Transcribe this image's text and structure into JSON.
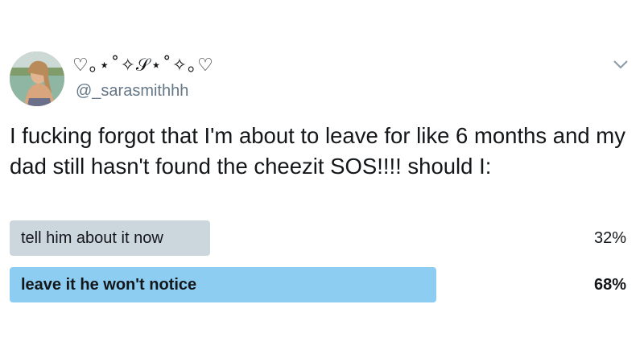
{
  "user": {
    "display_name": "♡｡⋆˚✧𝒮⋆˚✧｡♡",
    "handle": "@_sarasmithhh"
  },
  "tweet": {
    "text": "I fucking forgot that I'm about to leave for like 6 months and my dad still hasn't found the cheezit SOS!!!! should I:"
  },
  "poll": {
    "options": [
      {
        "label": "tell him about it now",
        "percent": "32%",
        "value": 32,
        "leading": false
      },
      {
        "label": "leave it he won't notice",
        "percent": "68%",
        "value": 68,
        "leading": true
      }
    ]
  },
  "colors": {
    "text": "#14171a",
    "secondary": "#657786",
    "poll_bar": "#ccd6dd",
    "poll_bar_leading": "#8ecdf2"
  },
  "icons": {
    "menu": "chevron-down-icon"
  }
}
